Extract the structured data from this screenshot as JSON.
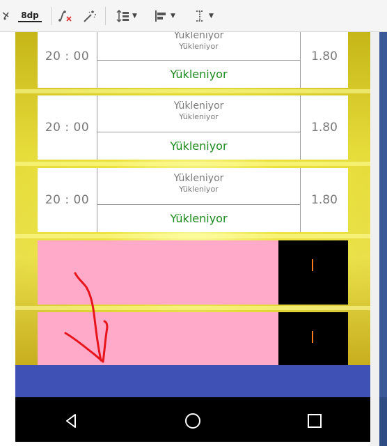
{
  "toolbar": {
    "dp_label": "8dp",
    "icons": [
      "constraint-icon",
      "dp-margin-icon",
      "clear-constraints-icon",
      "infer-constraints-icon",
      "pack-icon",
      "align-icon",
      "guidelines-icon"
    ]
  },
  "matches": [
    {
      "time": "20 : 00",
      "home": "Yükleniyor",
      "away": "Yükleniyor",
      "status": "Yükleniyor",
      "odd": "1.80"
    },
    {
      "time": "20 : 00",
      "home": "Yükleniyor",
      "away": "Yükleniyor",
      "status": "Yükleniyor",
      "odd": "1.80"
    },
    {
      "time": "20 : 00",
      "home": "Yükleniyor",
      "away": "Yükleniyor",
      "status": "Yükleniyor",
      "odd": "1.80"
    }
  ],
  "colors": {
    "pink_block": "#ffaac8",
    "status_green": "#1a8a1a",
    "bottom_bar_blue": "#3f51b5",
    "annotation_red": "#e8141b",
    "tick_orange": "#ff7a1a"
  },
  "navigation": {
    "back_icon": "back-triangle-icon",
    "home_icon": "home-circle-icon",
    "recents_icon": "recents-square-icon"
  }
}
